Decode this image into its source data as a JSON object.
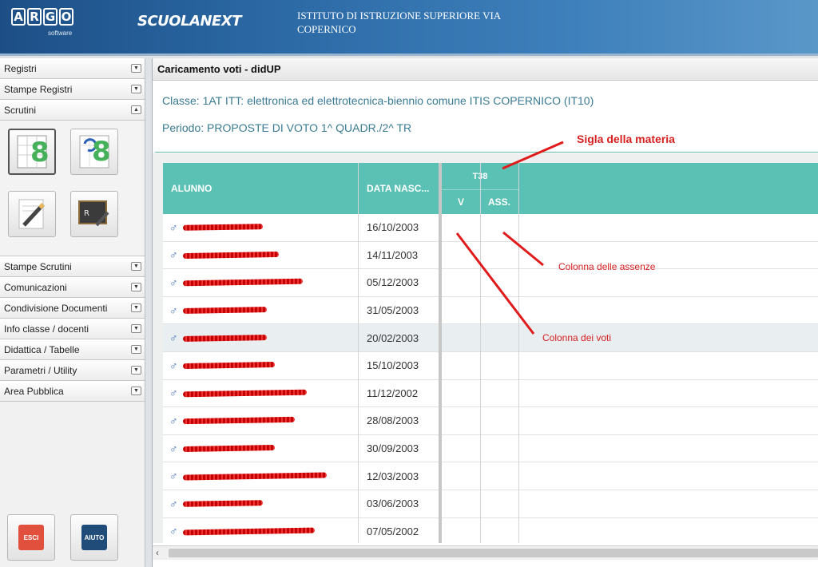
{
  "header": {
    "logo_letters": [
      "A",
      "R",
      "G",
      "O"
    ],
    "logo_sub": "software",
    "brand": "SCUOLANEXT",
    "school": "ISTITUTO DI ISTRUZIONE SUPERIORE VIA COPERNICO"
  },
  "sidebar": {
    "top_items": [
      {
        "label": "Registri",
        "arrow": "▼"
      },
      {
        "label": "Stampe Registri",
        "arrow": "▼"
      },
      {
        "label": "Scrutini",
        "arrow": "▲"
      }
    ],
    "bottom_items": [
      {
        "label": "Stampe Scrutini",
        "arrow": "▼"
      },
      {
        "label": "Comunicazioni",
        "arrow": "▼"
      },
      {
        "label": "Condivisione Documenti",
        "arrow": "▼"
      },
      {
        "label": "Info classe / docenti",
        "arrow": "▼"
      },
      {
        "label": "Didattica / Tabelle",
        "arrow": "▼"
      },
      {
        "label": "Parametri / Utility",
        "arrow": "▼"
      },
      {
        "label": "Area Pubblica",
        "arrow": "▼"
      }
    ],
    "icon_digit": "8",
    "esci_label": "ESCI",
    "aiuto_label": "AIUTO"
  },
  "main": {
    "title": "Caricamento voti - didUP",
    "classe": "Classe: 1AT ITT: elettronica ed elettrotecnica-biennio comune ITIS COPERNICO (IT10)",
    "periodo": "Periodo: PROPOSTE DI VOTO 1^ QUADR./2^ TR"
  },
  "grid": {
    "headers": {
      "alunno": "ALUNNO",
      "data": "DATA NASC...",
      "subject": "T38",
      "v": "V",
      "ass": "ASS."
    },
    "rows": [
      {
        "date": "16/10/2003"
      },
      {
        "date": "14/11/2003"
      },
      {
        "date": "05/12/2003"
      },
      {
        "date": "31/05/2003"
      },
      {
        "date": "20/02/2003"
      },
      {
        "date": "15/10/2003"
      },
      {
        "date": "11/12/2002"
      },
      {
        "date": "28/08/2003"
      },
      {
        "date": "30/09/2003"
      },
      {
        "date": "12/03/2003"
      },
      {
        "date": "03/06/2003"
      },
      {
        "date": "07/05/2002"
      }
    ]
  },
  "annotations": {
    "sigla": "Sigla della materia",
    "assenze": "Colonna delle assenze",
    "voti": "Colonna dei voti"
  },
  "colors": {
    "header_teal": "#5bc1b4",
    "annotation_red": "#d61f1f",
    "info_text": "#3a7b94"
  }
}
